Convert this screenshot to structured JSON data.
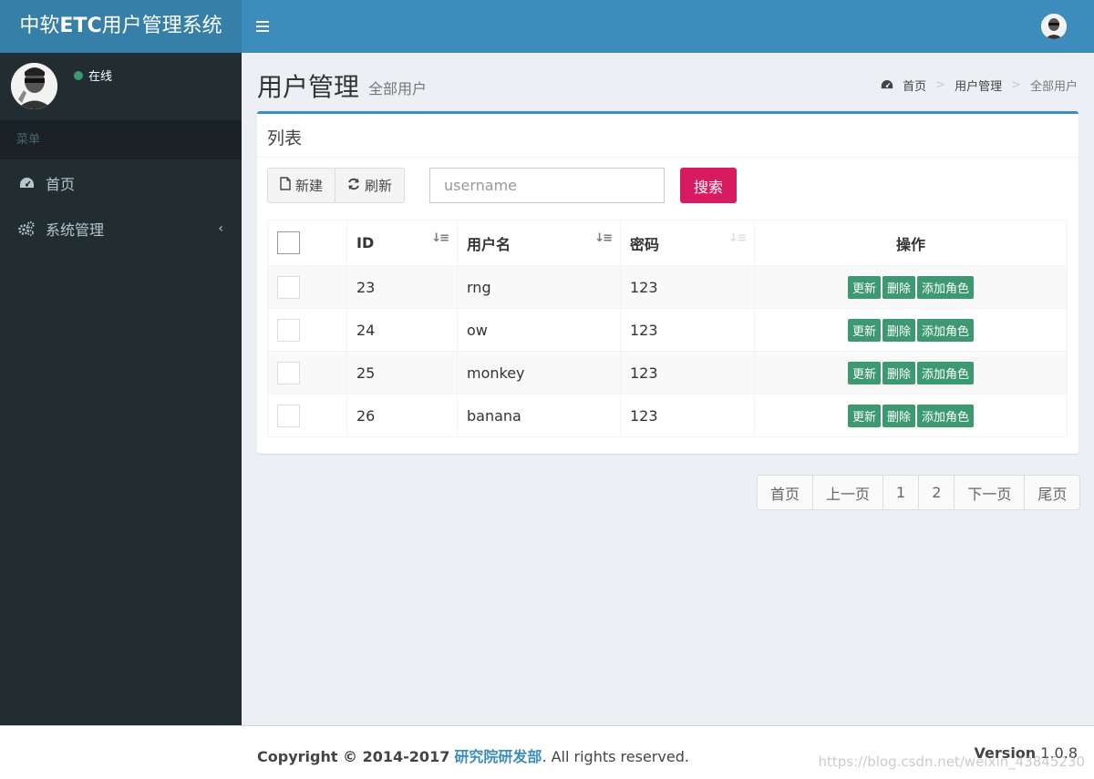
{
  "header": {
    "logo_prefix": "中软",
    "logo_bold": "ETC",
    "logo_suffix": "用户管理系统"
  },
  "sidebar": {
    "status": "在线",
    "menu_header": "菜单",
    "items": [
      {
        "label": "首页",
        "icon": "dashboard-icon"
      },
      {
        "label": "系统管理",
        "icon": "cogs-icon"
      }
    ]
  },
  "content_header": {
    "title": "用户管理",
    "subtitle": "全部用户",
    "breadcrumb": [
      "首页",
      "用户管理",
      "全部用户"
    ]
  },
  "box": {
    "title": "列表",
    "new_button": "新建",
    "refresh_button": "刷新",
    "search_placeholder": "username",
    "search_button": "搜索"
  },
  "table": {
    "columns": [
      "ID",
      "用户名",
      "密码",
      "操作"
    ],
    "rows": [
      {
        "id": "23",
        "username": "rng",
        "password": "123"
      },
      {
        "id": "24",
        "username": "ow",
        "password": "123"
      },
      {
        "id": "25",
        "username": "monkey",
        "password": "123"
      },
      {
        "id": "26",
        "username": "banana",
        "password": "123"
      }
    ],
    "actions": [
      "更新",
      "删除",
      "添加角色"
    ]
  },
  "pagination": [
    "首页",
    "上一页",
    "1",
    "2",
    "下一页",
    "尾页"
  ],
  "footer": {
    "copyright_prefix": "Copyright © 2014-2017",
    "org": "研究院研发部",
    "copyright_suffix": ". All rights reserved.",
    "version_label": "Version",
    "version_value": "1.0.8",
    "watermark": "https://blog.csdn.net/weixin_43845230"
  },
  "colors": {
    "header": "#3c8dbc",
    "logo_bg": "#367fa9",
    "sidebar": "#222d32",
    "search_button": "#d81b60",
    "action_button": "#3d9970"
  }
}
